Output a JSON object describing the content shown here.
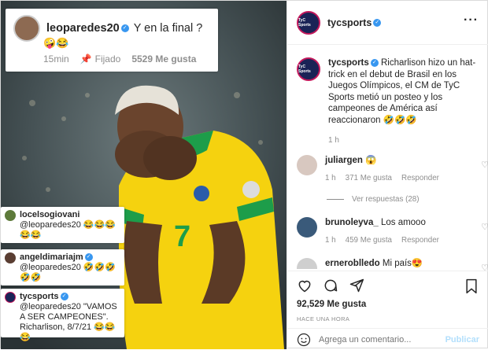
{
  "post": {
    "username": "tycsports",
    "caption": "Richarlison hizo un hat-trick en el debut de Brasil en los Juegos Olímpicos, el CM de TyC Sports metió un posteo y los campeones de América así reaccionaron 🤣🤣🤣",
    "caption_time": "1 h",
    "likes": "92,529 Me gusta",
    "timestamp": "HACE UNA HORA",
    "comment_placeholder": "Agrega un comentario...",
    "publish_label": "Publicar",
    "logo_text": "TyC Sports"
  },
  "comments": [
    {
      "user": "juliargen",
      "text": "😱",
      "time": "1 h",
      "likes": "371 Me gusta",
      "reply": "Responder"
    },
    {
      "user": "brunoleyva_",
      "text": "Los amooo",
      "time": "1 h",
      "likes": "459 Me gusta",
      "reply": "Responder"
    },
    {
      "user": "erneroblledo",
      "text": "Mi país😍"
    }
  ],
  "replies_link": "Ver respuestas (28)",
  "overlay": {
    "top": {
      "user": "leoparedes20",
      "text": "Y en la final ?",
      "emojis": "🤪😂",
      "time": "15min",
      "pinned": "Fijado",
      "likes": "5529 Me gusta"
    },
    "small": [
      {
        "user": "locelsogiovani",
        "mention": "@leoparedes20",
        "emojis": "😂😂😂😂😂"
      },
      {
        "user": "angeldimariajm",
        "mention": "@leoparedes20",
        "emojis": "🤣🤣🤣🤣🤣"
      },
      {
        "user": "tycsports",
        "mention": "@leoparedes20",
        "text": "\"VAMOS A SER CAMPEONES\". Richarlison, 8/7/21",
        "emojis": "😂😂😂"
      }
    ]
  },
  "colors": {
    "verified": "#3897f0",
    "jersey": "#f5d20f",
    "collar": "#1d9d4a",
    "photo_bg": "#3e4a4e"
  },
  "icons": [
    "heart-icon",
    "comment-icon",
    "share-icon",
    "bookmark-icon",
    "emoji-icon",
    "more-icon",
    "verified-icon"
  ]
}
